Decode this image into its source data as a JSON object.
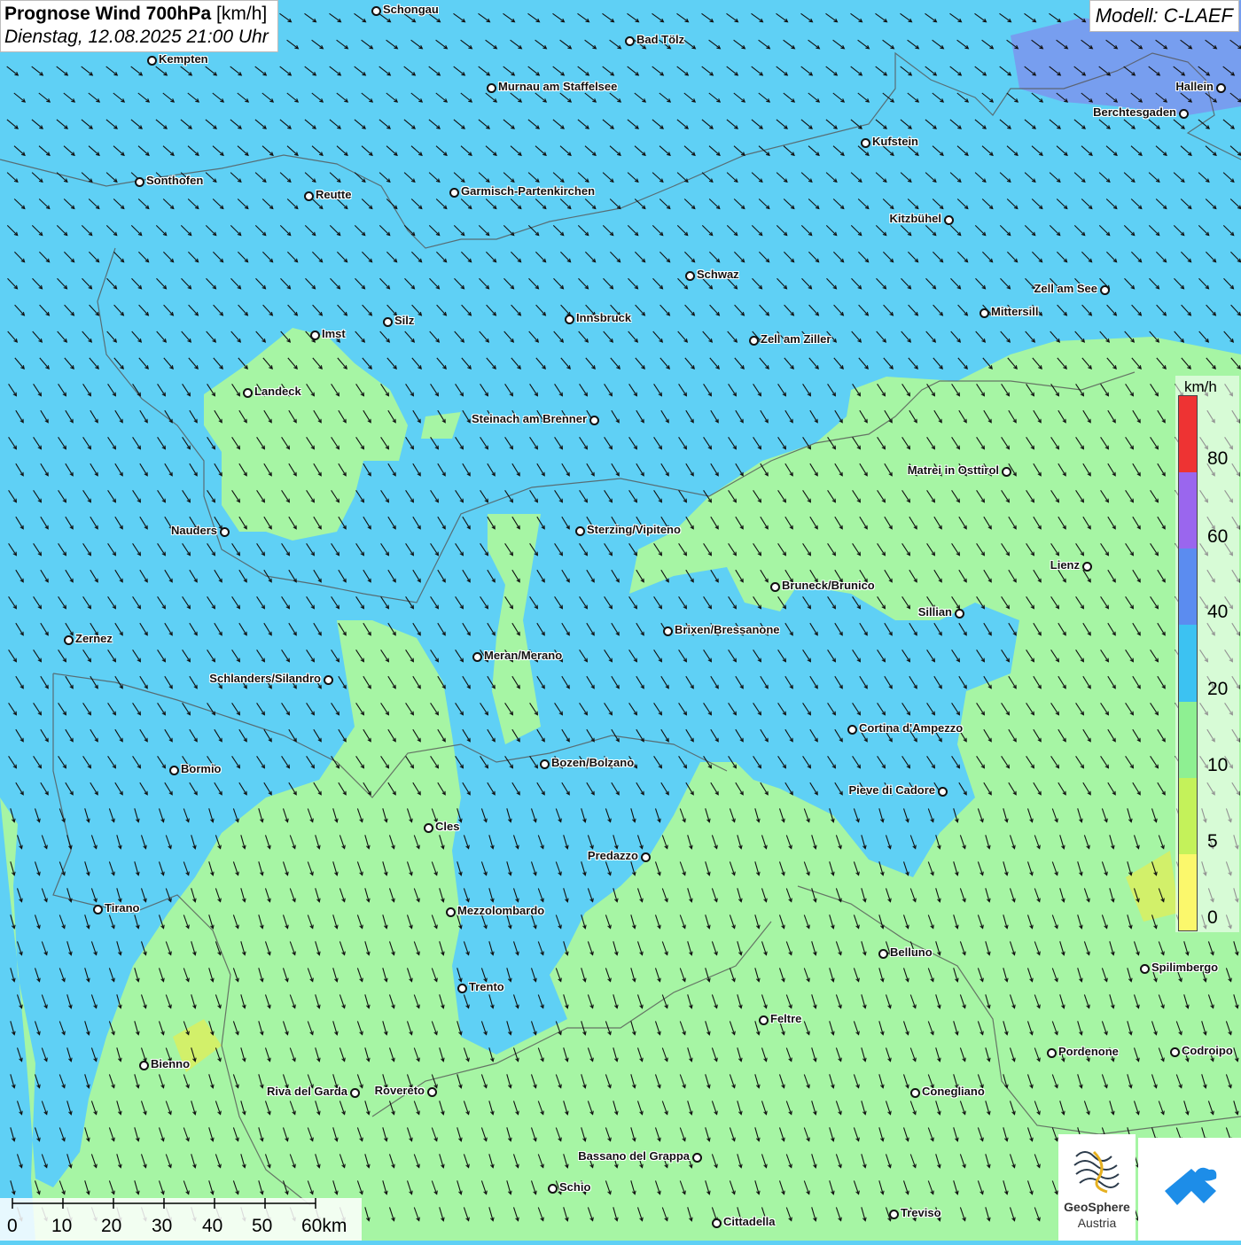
{
  "title": {
    "main": "Prognose Wind 700hPa",
    "unit": "[km/h]",
    "subtitle": "Dienstag, 12.08.2025 21:00 Uhr"
  },
  "model": "Modell: C-LAEF",
  "legend": {
    "unit": "km/h",
    "ticks": [
      "80",
      "60",
      "40",
      "20",
      "10",
      "5",
      "0"
    ],
    "colors": [
      "#ee3333",
      "#9a66ee",
      "#5b8cf0",
      "#3cc2f2",
      "#8ef092",
      "#c4f25a",
      "#fbf86c"
    ]
  },
  "scale": {
    "labels": [
      "0",
      "10",
      "20",
      "30",
      "40",
      "50",
      "60km"
    ]
  },
  "logos": {
    "geosphere_line1": "GeoSphere",
    "geosphere_line2": "Austria"
  },
  "cities": [
    {
      "name": "Schongau"
    },
    {
      "name": "Bad Tölz"
    },
    {
      "name": "Kempten"
    },
    {
      "name": "Murnau am Staffelsee"
    },
    {
      "name": "Hallein"
    },
    {
      "name": "Berchtesgaden"
    },
    {
      "name": "Kufstein"
    },
    {
      "name": "Sonthofen"
    },
    {
      "name": "Reutte"
    },
    {
      "name": "Garmisch-Partenkirchen"
    },
    {
      "name": "Kitzbühel"
    },
    {
      "name": "Schwaz"
    },
    {
      "name": "Zell am See"
    },
    {
      "name": "Mittersill"
    },
    {
      "name": "Imst"
    },
    {
      "name": "Silz"
    },
    {
      "name": "Innsbruck"
    },
    {
      "name": "Zell am Ziller"
    },
    {
      "name": "Landeck"
    },
    {
      "name": "Steinach am Brenner"
    },
    {
      "name": "Matrei in Osttirol"
    },
    {
      "name": "Nauders"
    },
    {
      "name": "Sterzing/Vipiteno"
    },
    {
      "name": "Lienz"
    },
    {
      "name": "Bruneck/Brunico"
    },
    {
      "name": "Sillian"
    },
    {
      "name": "Zernez"
    },
    {
      "name": "Brixen/Bressanone"
    },
    {
      "name": "Meran/Merano"
    },
    {
      "name": "Schlanders/Silandro"
    },
    {
      "name": "Cortina d'Ampezzo"
    },
    {
      "name": "Bozen/Bolzano"
    },
    {
      "name": "Bormio"
    },
    {
      "name": "Pieve di Cadore"
    },
    {
      "name": "Cles"
    },
    {
      "name": "Predazzo"
    },
    {
      "name": "Tirano"
    },
    {
      "name": "Mezzolombardo"
    },
    {
      "name": "Belluno"
    },
    {
      "name": "Spilimbergo"
    },
    {
      "name": "Trento"
    },
    {
      "name": "Feltre"
    },
    {
      "name": "Pordenone"
    },
    {
      "name": "Codroipo"
    },
    {
      "name": "Bienno"
    },
    {
      "name": "Riva del Garda"
    },
    {
      "name": "Rovereto"
    },
    {
      "name": "Conegliano"
    },
    {
      "name": "Bassano del Grappa"
    },
    {
      "name": "Schio"
    },
    {
      "name": "Treviso"
    },
    {
      "name": "Cittadella"
    }
  ]
}
